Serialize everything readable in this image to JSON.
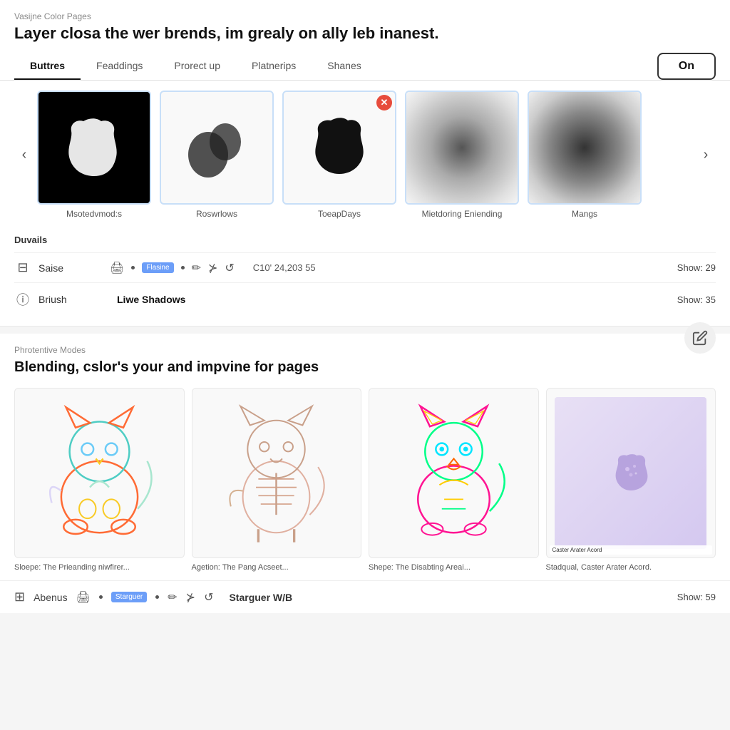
{
  "app": {
    "name": "Vasijne Color Pages"
  },
  "top": {
    "title": "Layer closa the wer brends, im grealy on ally leb inanest.",
    "tabs": [
      {
        "id": "buttres",
        "label": "Buttres",
        "active": true
      },
      {
        "id": "feaddings",
        "label": "Feaddings",
        "active": false
      },
      {
        "id": "prorect-up",
        "label": "Prorect up",
        "active": false
      },
      {
        "id": "platnerips",
        "label": "Platnerips",
        "active": false
      },
      {
        "id": "shanes",
        "label": "Shanes",
        "active": false
      }
    ],
    "on_button": "On"
  },
  "brushes": {
    "items": [
      {
        "id": "1",
        "label": "Msotedvmod:s",
        "type": "blob-white-on-black"
      },
      {
        "id": "2",
        "label": "Roswrlows",
        "type": "blob-dark"
      },
      {
        "id": "3",
        "label": "ToeapDays",
        "type": "blob-black",
        "has_close": true
      },
      {
        "id": "4",
        "label": "Mietdoring Eniending",
        "type": "blur"
      },
      {
        "id": "5",
        "label": "Mangs",
        "type": "blur-light"
      }
    ],
    "arrow_left": "‹",
    "arrow_right": "›"
  },
  "details": {
    "title": "Duvails",
    "rows": [
      {
        "id": "saise",
        "icon": "grid",
        "name": "Saise",
        "meta": "C10' 24,203 55",
        "show": "Show: 29",
        "has_tools": true,
        "tag": "Flasine"
      },
      {
        "id": "briush",
        "icon": "circle",
        "name": "Briush",
        "center": "Liwe Shadows",
        "show": "Show: 35",
        "has_tools": false
      }
    ]
  },
  "bottom": {
    "subtitle": "Phrotentive Modes",
    "heading": "Blending, cslor's your and impvine for pages",
    "gallery": [
      {
        "id": "1",
        "label": "Sloepe: The Prieanding niwfirer...",
        "type": "colorful-cat-1"
      },
      {
        "id": "2",
        "label": "Agetion: The Pang Acseet...",
        "type": "skeleton-cat"
      },
      {
        "id": "3",
        "label": "Shepe: The Disabting Areai...",
        "type": "neon-cat"
      },
      {
        "id": "4",
        "label": "Stadqual, Caster Arater Acord.",
        "type": "purple-blob-preview"
      }
    ]
  },
  "toolbar_bottom": {
    "icon_grid": "⊞",
    "name": "Abenus",
    "tag": "Starguer",
    "center": "Starguer W/B",
    "show": "Show: 59"
  }
}
